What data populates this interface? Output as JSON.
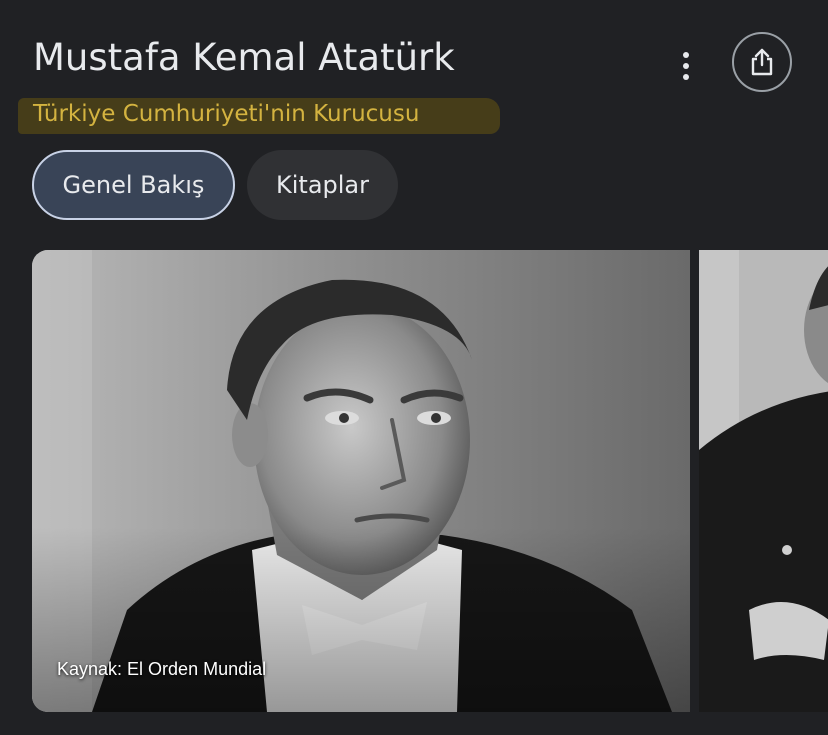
{
  "header": {
    "title": "Mustafa Kemal Atatürk",
    "subtitle": "Türkiye Cumhuriyeti'nin Kurucusu",
    "more_icon": "more-vert-icon",
    "share_icon": "share-icon"
  },
  "tabs": [
    {
      "label": "Genel Bakış",
      "active": true
    },
    {
      "label": "Kitaplar",
      "active": false
    }
  ],
  "images": {
    "main_caption": "Kaynak: El Orden Mundial"
  },
  "colors": {
    "background": "#202124",
    "subtitle_text": "#d4b340",
    "highlight": "#4a4018",
    "active_chip": "#394457",
    "inactive_chip": "#303134"
  }
}
